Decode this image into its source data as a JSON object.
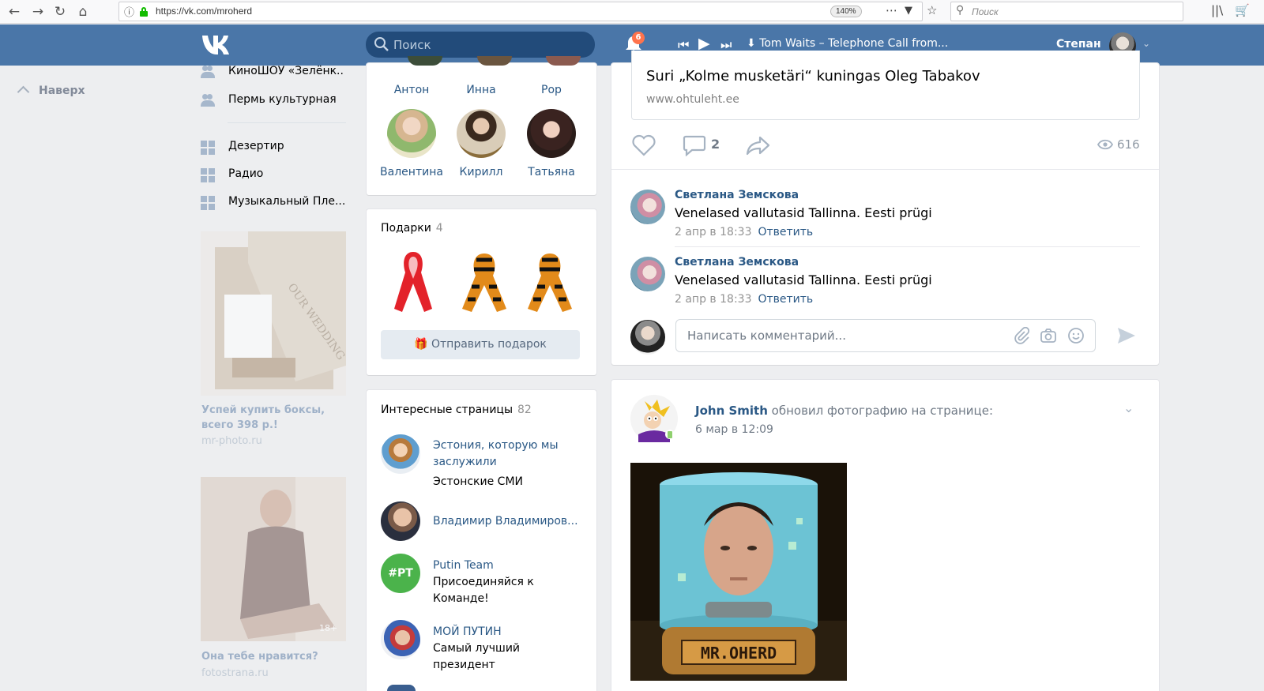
{
  "browser": {
    "url": "https://vk.com/mroherd",
    "zoom": "140%",
    "search_placeholder": "Поиск",
    "icons": [
      "back-icon",
      "forward-icon",
      "reload-icon",
      "home-icon",
      "info-icon",
      "lock-icon",
      "more-icon",
      "pocket-icon",
      "bookmark-star-icon",
      "library-icon",
      "cart-icon"
    ]
  },
  "header": {
    "search_placeholder": "Поиск",
    "notifications_count": "6",
    "track": "Tom Waits – Telephone Call from...",
    "username": "Степан"
  },
  "left": {
    "up_label": "Наверх",
    "groups": [
      "КиноШОУ «Зелёнк..",
      "Пермь культурная"
    ],
    "apps": [
      "Дезертир",
      "Радио",
      "Музыкальный Пле..."
    ],
    "ads": [
      {
        "title": "Успей купить боксы, всего 398 р.!",
        "domain": "mr-photo.ru",
        "image_caption": "OUR WEDDING"
      },
      {
        "title": "Она тебе нравится?",
        "domain": "fotostrana.ru",
        "badge": "18+"
      }
    ]
  },
  "friends": {
    "row1": [
      "Антон",
      "Инна",
      "Рор"
    ],
    "row2": [
      "Валентина",
      "Кирилл",
      "Татьяна"
    ]
  },
  "gifts": {
    "title": "Подарки",
    "count": "4",
    "send_label": "Отправить подарок"
  },
  "interesting": {
    "title": "Интересные страницы",
    "count": "82",
    "items": [
      {
        "name": "Эстония, которую мы заслужили",
        "desc": "Эстонские СМИ"
      },
      {
        "name": "Владимир Владимиров...",
        "desc": ""
      },
      {
        "name": "Putin Team",
        "desc": "Присоединяйся к Команде!",
        "avatar_text": "#PT"
      },
      {
        "name": "МОЙ ПУТИН",
        "desc": "Самый лучший президент"
      }
    ]
  },
  "post1": {
    "link_title": "Suri „Kolme musketäri“ kuningas Oleg Tabakov",
    "link_domain": "www.ohtuleht.ee",
    "comments_count": "2",
    "views": "616",
    "comments": [
      {
        "author": "Светлана Земскова",
        "text": "Venelased vallutasid Tallinna. Eesti prügi",
        "date": "2 апр в 18:33",
        "reply": "Ответить"
      },
      {
        "author": "Светлана Земскова",
        "text": "Venelased vallutasid Tallinna. Eesti prügi",
        "date": "2 апр в 18:33",
        "reply": "Ответить"
      }
    ],
    "comment_placeholder": "Написать комментарий..."
  },
  "post2": {
    "author": "John Smith",
    "action": "обновил фотографию на странице:",
    "date": "6 мар в 12:09",
    "image_label": "MR.OHERD"
  },
  "colors": {
    "header_blue": "#4a76a8",
    "link_blue": "#2a5885",
    "page_bg": "#edeef0",
    "badge_red": "#ff734c"
  }
}
